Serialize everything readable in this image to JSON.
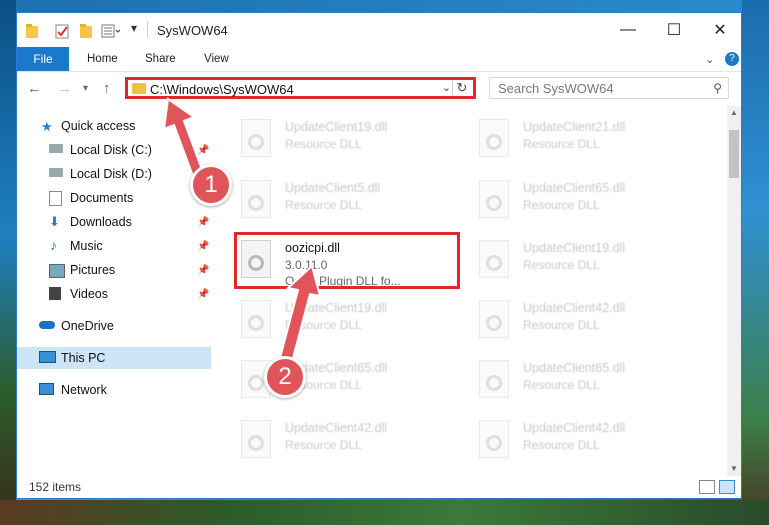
{
  "window": {
    "title": "SysWOW64",
    "controls": {
      "minimize": "—",
      "maximize": "☐",
      "close": "✕"
    }
  },
  "ribbon": {
    "tabs": [
      "File",
      "Home",
      "Share",
      "View"
    ],
    "chevron": "⌄",
    "help": "?"
  },
  "address_bar": {
    "path": "C:\\Windows\\SysWOW64",
    "search_placeholder": "Search SysWOW64"
  },
  "nav_pane": {
    "items": [
      {
        "label": "Quick access",
        "icon": "star-icon",
        "pinned": false
      },
      {
        "label": "Local Disk (C:)",
        "icon": "drive-icon",
        "pinned": true
      },
      {
        "label": "Local Disk (D:)",
        "icon": "drive-icon",
        "pinned": false
      },
      {
        "label": "Documents",
        "icon": "documents-icon",
        "pinned": true
      },
      {
        "label": "Downloads",
        "icon": "download-icon",
        "pinned": true
      },
      {
        "label": "Music",
        "icon": "music-icon",
        "pinned": true
      },
      {
        "label": "Pictures",
        "icon": "pictures-icon",
        "pinned": true
      },
      {
        "label": "Videos",
        "icon": "videos-icon",
        "pinned": true
      },
      {
        "label": "OneDrive",
        "icon": "cloud-icon",
        "pinned": false
      },
      {
        "label": "This PC",
        "icon": "computer-icon",
        "pinned": false,
        "selected": true
      },
      {
        "label": "Network",
        "icon": "network-icon",
        "pinned": false
      }
    ]
  },
  "files": [
    {
      "name": "UpdateClient19.dll",
      "line2": "Resource DLL",
      "blurred": true
    },
    {
      "name": "UpdateClient21.dll",
      "line2": "Resource DLL",
      "blurred": true
    },
    {
      "name": "UpdateClient5.dll",
      "line2": "Resource DLL",
      "blurred": true
    },
    {
      "name": "UpdateClient65.dll",
      "line2": "Resource DLL",
      "blurred": true
    },
    {
      "name": "oozicpi.dll",
      "line2": "3.0.11.0",
      "line3": "Oozic Plugin DLL fo...",
      "blurred": false
    },
    {
      "name": "UpdateClient19.dll",
      "line2": "Resource DLL",
      "blurred": true
    },
    {
      "name": "UpdateClient19.dll",
      "line2": "Resource DLL",
      "blurred": true
    },
    {
      "name": "UpdateClient42.dll",
      "line2": "Resource DLL",
      "blurred": true
    },
    {
      "name": "UpdateClient65.dll",
      "line2": "Resource DLL",
      "blurred": true
    },
    {
      "name": "UpdateClient65.dll",
      "line2": "Resource DLL",
      "blurred": true
    },
    {
      "name": "UpdateClient42.dll",
      "line2": "Resource DLL",
      "blurred": true
    },
    {
      "name": "UpdateClient42.dll",
      "line2": "Resource DLL",
      "blurred": true
    }
  ],
  "status_bar": {
    "item_count": "152 items"
  },
  "annotations": {
    "step1": "1",
    "step2": "2"
  },
  "colors": {
    "accent": "#1979ca",
    "highlight": "#e02a2a",
    "badge": "#e0555a",
    "selection": "#cce4f7"
  }
}
